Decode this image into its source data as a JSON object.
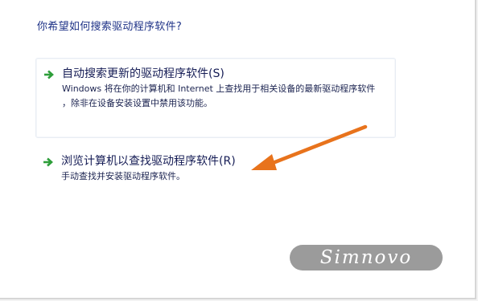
{
  "dialog": {
    "heading": "你希望如何搜索驱动程序软件?"
  },
  "options": [
    {
      "title": "自动搜索更新的驱动程序软件(S)",
      "description_line1": "Windows 将在你的计算机和 Internet 上查找用于相关设备的最新驱动程序软件",
      "description_line2": "，除非在设备安装设置中禁用该功能。",
      "icon": "green-arrow-icon"
    },
    {
      "title": "浏览计算机以查找驱动程序软件(R)",
      "description_line1": "手动查找并安装驱动程序软件。",
      "icon": "green-arrow-icon"
    }
  ],
  "annotation": {
    "arrow_color": "#e8731c"
  },
  "watermark": {
    "text": "Simnovo"
  },
  "colors": {
    "heading": "#1e3287",
    "option_arrow": "#2e9e3a",
    "watermark_bg": "#9b9b9b"
  }
}
